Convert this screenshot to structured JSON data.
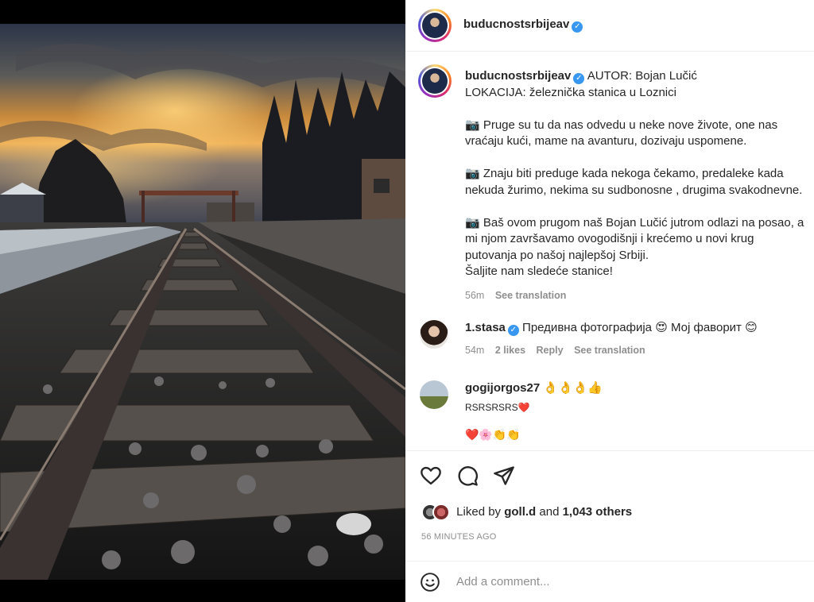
{
  "post": {
    "username": "buducnostsrbijeav",
    "verified_glyph": "✓",
    "photo_alt": "Railway tracks at sunset"
  },
  "caption": {
    "username": "buducnostsrbijeav",
    "first_line": "AUTOR: Bojan Lučić",
    "line2": "LOKACIJA: železnička stanica u Loznici",
    "p1_l1": "📷 Pruge su tu da nas odvedu u neke nove živote, one nas",
    "p1_l2": "vraćaju kući, mame na avanturu, dozivaju uspomene.",
    "p2_l1": "📷 Znaju biti preduge kada nekoga čekamo, predaleke kada",
    "p2_l2": "nekuda žurimo, nekima su sudbonosne , drugima svakodnevne.",
    "p3_l1": "📷 Baš ovom prugom naš Bojan Lučić jutrom odlazi na posao, a",
    "p3_l2": "mi njom završavamo ovogodišnji i krećemo u novi krug",
    "p3_l3": "putovanja po našoj najlepšoj Srbiji.",
    "p3_l4": "Šaljite nam sledeće stanice!",
    "age": "56m",
    "see_translation": "See translation"
  },
  "comments": [
    {
      "username": "1.stasa",
      "text": "Предивна фотографија 😍 Мој фаворит 😊",
      "age": "54m",
      "likes": "2 likes",
      "reply": "Reply",
      "see_translation": "See translation"
    },
    {
      "username": "gogijorgos27",
      "emoji_line": "👌👌👌👍",
      "line2": "RSRSRSRS❤️",
      "line3": "❤️🌸👏👏"
    }
  ],
  "actions": {
    "like_icon": "heart-icon",
    "comment_icon": "comment-icon",
    "share_icon": "share-icon"
  },
  "likes": {
    "prefix": "Liked by",
    "user": "goll.d",
    "and": "and",
    "others": "1,043 others"
  },
  "timestamp": "56 MINUTES AGO",
  "add_comment": {
    "placeholder": "Add a comment..."
  }
}
